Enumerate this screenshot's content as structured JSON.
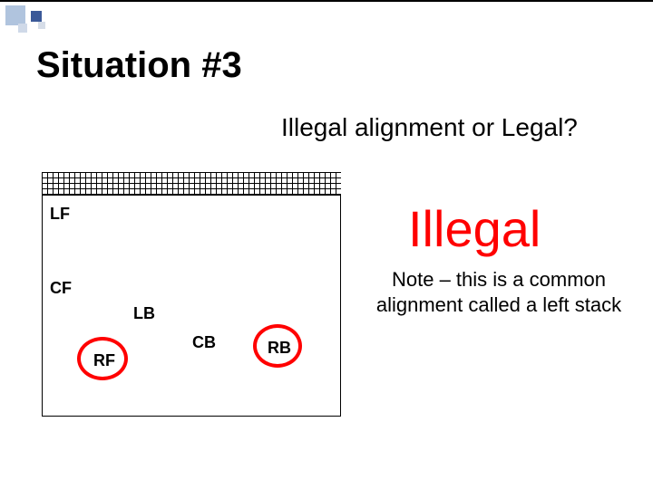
{
  "title": "Situation #3",
  "question": "Illegal alignment or Legal?",
  "verdict": "Illegal",
  "note": "Note – this is a common alignment called a left stack",
  "positions": {
    "lf": "LF",
    "cf": "CF",
    "lb": "LB",
    "cb": "CB",
    "rb": "RB",
    "rf": "RF"
  }
}
